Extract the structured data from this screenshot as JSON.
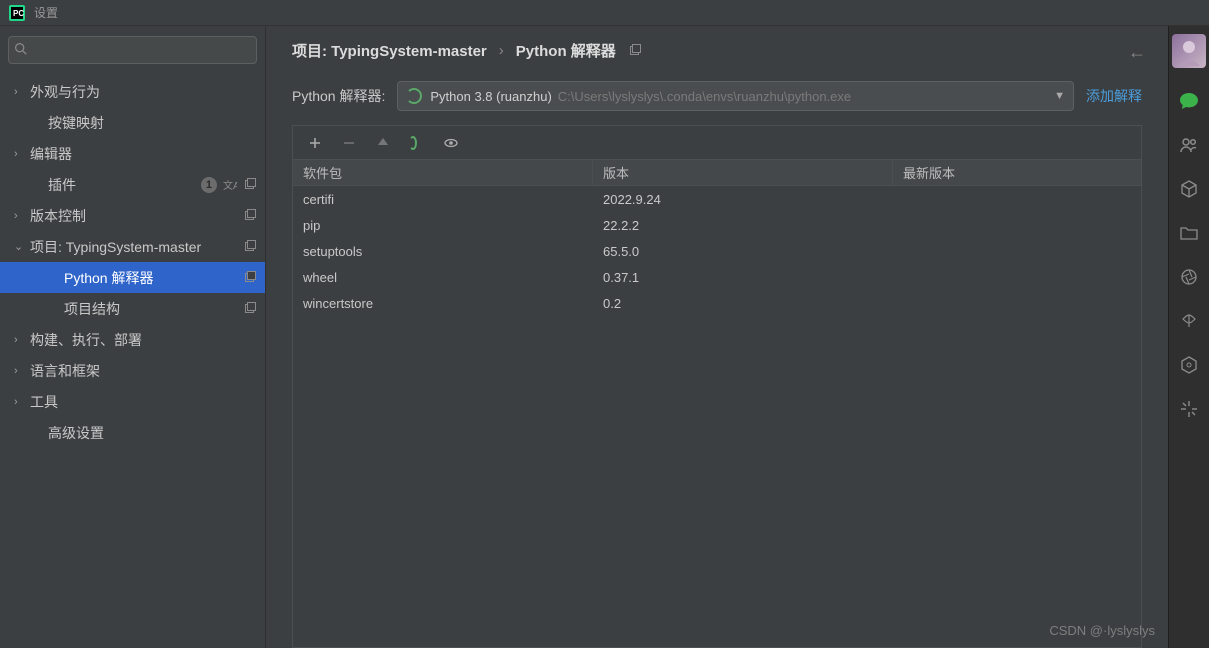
{
  "titlebar": {
    "title": "设置"
  },
  "sidebar": {
    "search_placeholder": "",
    "items": [
      {
        "label": "外观与行为",
        "type": "group"
      },
      {
        "label": "按键映射",
        "type": "child"
      },
      {
        "label": "编辑器",
        "type": "group"
      },
      {
        "label": "插件",
        "type": "child",
        "badge": "1",
        "icons": [
          "translate",
          "restore"
        ]
      },
      {
        "label": "版本控制",
        "type": "group",
        "icons": [
          "restore"
        ]
      },
      {
        "label": "项目: TypingSystem-master",
        "type": "group",
        "expanded": true,
        "icons": [
          "restore"
        ]
      },
      {
        "label": "Python 解释器",
        "type": "grandchild",
        "selected": true,
        "icons": [
          "restore"
        ]
      },
      {
        "label": "项目结构",
        "type": "grandchild",
        "icons": [
          "restore"
        ]
      },
      {
        "label": "构建、执行、部署",
        "type": "group"
      },
      {
        "label": "语言和框架",
        "type": "group"
      },
      {
        "label": "工具",
        "type": "group"
      },
      {
        "label": "高级设置",
        "type": "child"
      }
    ]
  },
  "breadcrumb": {
    "part1": "项目: TypingSystem-master",
    "sep": "›",
    "part2": "Python 解释器"
  },
  "interpreter": {
    "label": "Python 解释器:",
    "name": "Python 3.8 (ruanzhu)",
    "path": "C:\\Users\\lyslyslys\\.conda\\envs\\ruanzhu\\python.exe",
    "add_label": "添加解释"
  },
  "packages": {
    "columns": [
      "软件包",
      "版本",
      "最新版本"
    ],
    "rows": [
      {
        "name": "certifi",
        "version": "2022.9.24",
        "latest": ""
      },
      {
        "name": "pip",
        "version": "22.2.2",
        "latest": ""
      },
      {
        "name": "setuptools",
        "version": "65.5.0",
        "latest": ""
      },
      {
        "name": "wheel",
        "version": "0.37.1",
        "latest": ""
      },
      {
        "name": "wincertstore",
        "version": "0.2",
        "latest": ""
      }
    ]
  },
  "watermark": "CSDN @·lyslyslys"
}
